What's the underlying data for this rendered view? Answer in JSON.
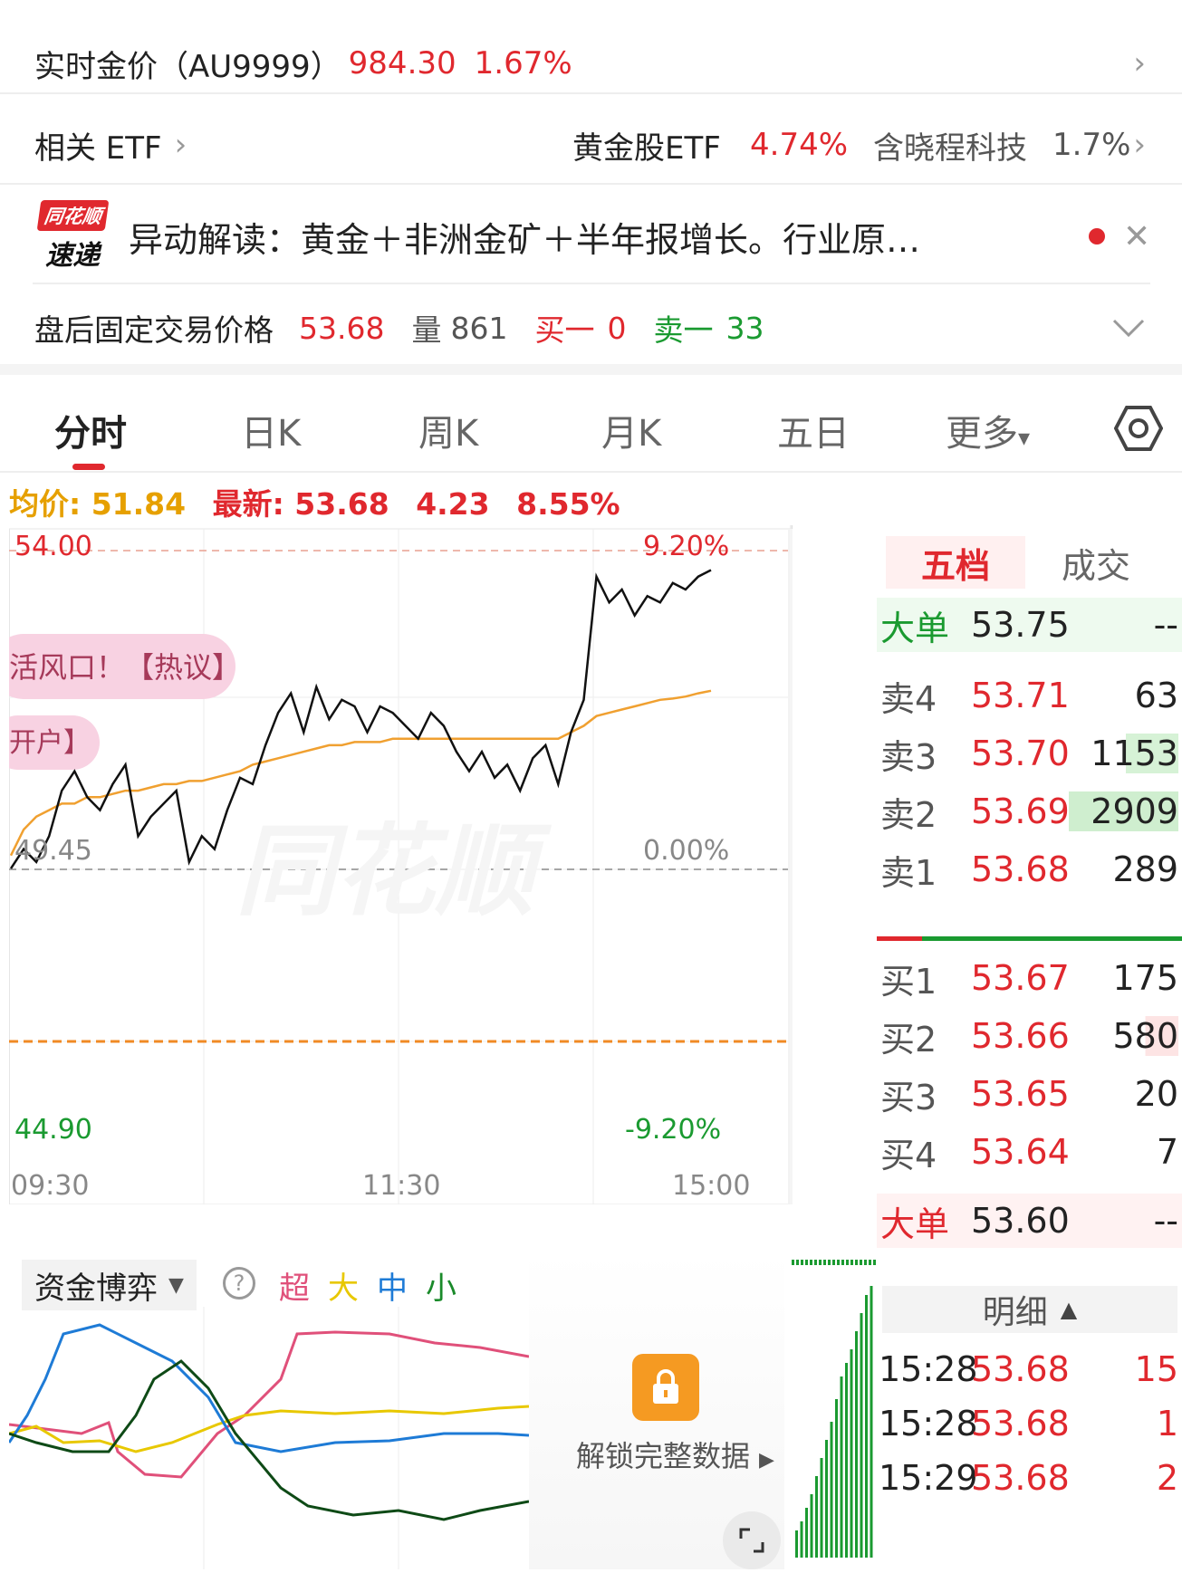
{
  "gold": {
    "label": "实时金价（AU9999）",
    "price": "984.30",
    "change": "1.67%"
  },
  "etf": {
    "label": "相关 ETF",
    "item1_name": "黄金股ETF",
    "item1_change": "4.74%",
    "item2_name": "含晓程科技",
    "item2_change": "1.7%"
  },
  "news": {
    "logo_top": "同花顺",
    "logo_bottom": "速递",
    "text": "异动解读：黄金＋非洲金矿＋半年报增长。行业原…"
  },
  "after_hours": {
    "label": "盘后固定交易价格",
    "price": "53.68",
    "volume_label": "量",
    "volume": "861",
    "bid_label": "买一",
    "bid": "0",
    "ask_label": "卖一",
    "ask": "33"
  },
  "tabs": [
    "分时",
    "日K",
    "周K",
    "月K",
    "五日",
    "更多"
  ],
  "price_line": {
    "avg_label": "均价:",
    "avg": "51.84",
    "latest_label": "最新:",
    "latest": "53.68",
    "change": "4.23",
    "change_pct": "8.55%"
  },
  "chart_labels": {
    "top": "54.00",
    "top_pct": "9.20%",
    "mid": "49.45",
    "mid_pct": "0.00%",
    "bottom": "44.90",
    "bottom_pct": "-9.20%",
    "t_start": "09:30",
    "t_mid": "11:30",
    "t_end": "15:00",
    "bubble1": "活风口！【热议】",
    "bubble2": "开户】",
    "watermark": "同花顺"
  },
  "chart_data": {
    "type": "line",
    "series": [
      {
        "name": "最新",
        "values": [
          49.1,
          49.4,
          49.2,
          49.6,
          50.3,
          50.6,
          50.2,
          50.0,
          50.4,
          50.7,
          49.6,
          49.9,
          50.1,
          50.3,
          49.2,
          49.6,
          49.4,
          50.0,
          50.5,
          50.4,
          51.0,
          51.5,
          51.8,
          51.2,
          51.9,
          51.4,
          51.7,
          51.6,
          51.2,
          51.6,
          51.5,
          51.3,
          51.1,
          51.5,
          51.3,
          50.9,
          50.6,
          50.9,
          50.5,
          50.7,
          50.3,
          50.8,
          51.0,
          50.4,
          51.2,
          51.7,
          53.6,
          53.2,
          53.4,
          53.0,
          53.3,
          53.2,
          53.5,
          53.4,
          53.6,
          53.7
        ]
      },
      {
        "name": "均价",
        "values": [
          49.3,
          49.7,
          49.9,
          50.0,
          50.1,
          50.1,
          50.2,
          50.2,
          50.25,
          50.3,
          50.3,
          50.35,
          50.4,
          50.4,
          50.45,
          50.45,
          50.5,
          50.55,
          50.6,
          50.7,
          50.75,
          50.8,
          50.85,
          50.9,
          50.95,
          51.0,
          51.0,
          51.05,
          51.05,
          51.05,
          51.1,
          51.1,
          51.1,
          51.1,
          51.1,
          51.1,
          51.1,
          51.1,
          51.1,
          51.1,
          51.1,
          51.1,
          51.1,
          51.1,
          51.2,
          51.3,
          51.45,
          51.5,
          51.55,
          51.6,
          51.65,
          51.7,
          51.72,
          51.75,
          51.8,
          51.84
        ]
      }
    ],
    "ylim": [
      44.9,
      54.0
    ],
    "x_ticks": [
      "09:30",
      "11:30",
      "15:00"
    ]
  },
  "book": {
    "tab_active": "五档",
    "tab_other": "成交",
    "big_sell": {
      "label": "大单",
      "price": "53.75",
      "vol": "--"
    },
    "asks": [
      {
        "label": "卖4",
        "price": "53.71",
        "vol": "63"
      },
      {
        "label": "卖3",
        "price": "53.70",
        "vol": "1153"
      },
      {
        "label": "卖2",
        "price": "53.69",
        "vol": "2909"
      },
      {
        "label": "卖1",
        "price": "53.68",
        "vol": "289"
      }
    ],
    "bids": [
      {
        "label": "买1",
        "price": "53.67",
        "vol": "175"
      },
      {
        "label": "买2",
        "price": "53.66",
        "vol": "580"
      },
      {
        "label": "买3",
        "price": "53.65",
        "vol": "20"
      },
      {
        "label": "买4",
        "price": "53.64",
        "vol": "7"
      }
    ],
    "big_buy": {
      "label": "大单",
      "price": "53.60",
      "vol": "--"
    }
  },
  "capital": {
    "select_label": "资金博弈",
    "legend": [
      "超",
      "大",
      "中",
      "小"
    ],
    "legend_colors": [
      "#e0507a",
      "#e8c800",
      "#1e7bd6",
      "#1a8a2a"
    ],
    "unlock_text": "解锁完整数据"
  },
  "detail": {
    "header": "明细",
    "rows": [
      {
        "time": "15:28",
        "price": "53.68",
        "vol": "15"
      },
      {
        "time": "15:28",
        "price": "53.68",
        "vol": "1"
      },
      {
        "time": "15:29",
        "price": "53.68",
        "vol": "2"
      }
    ]
  }
}
